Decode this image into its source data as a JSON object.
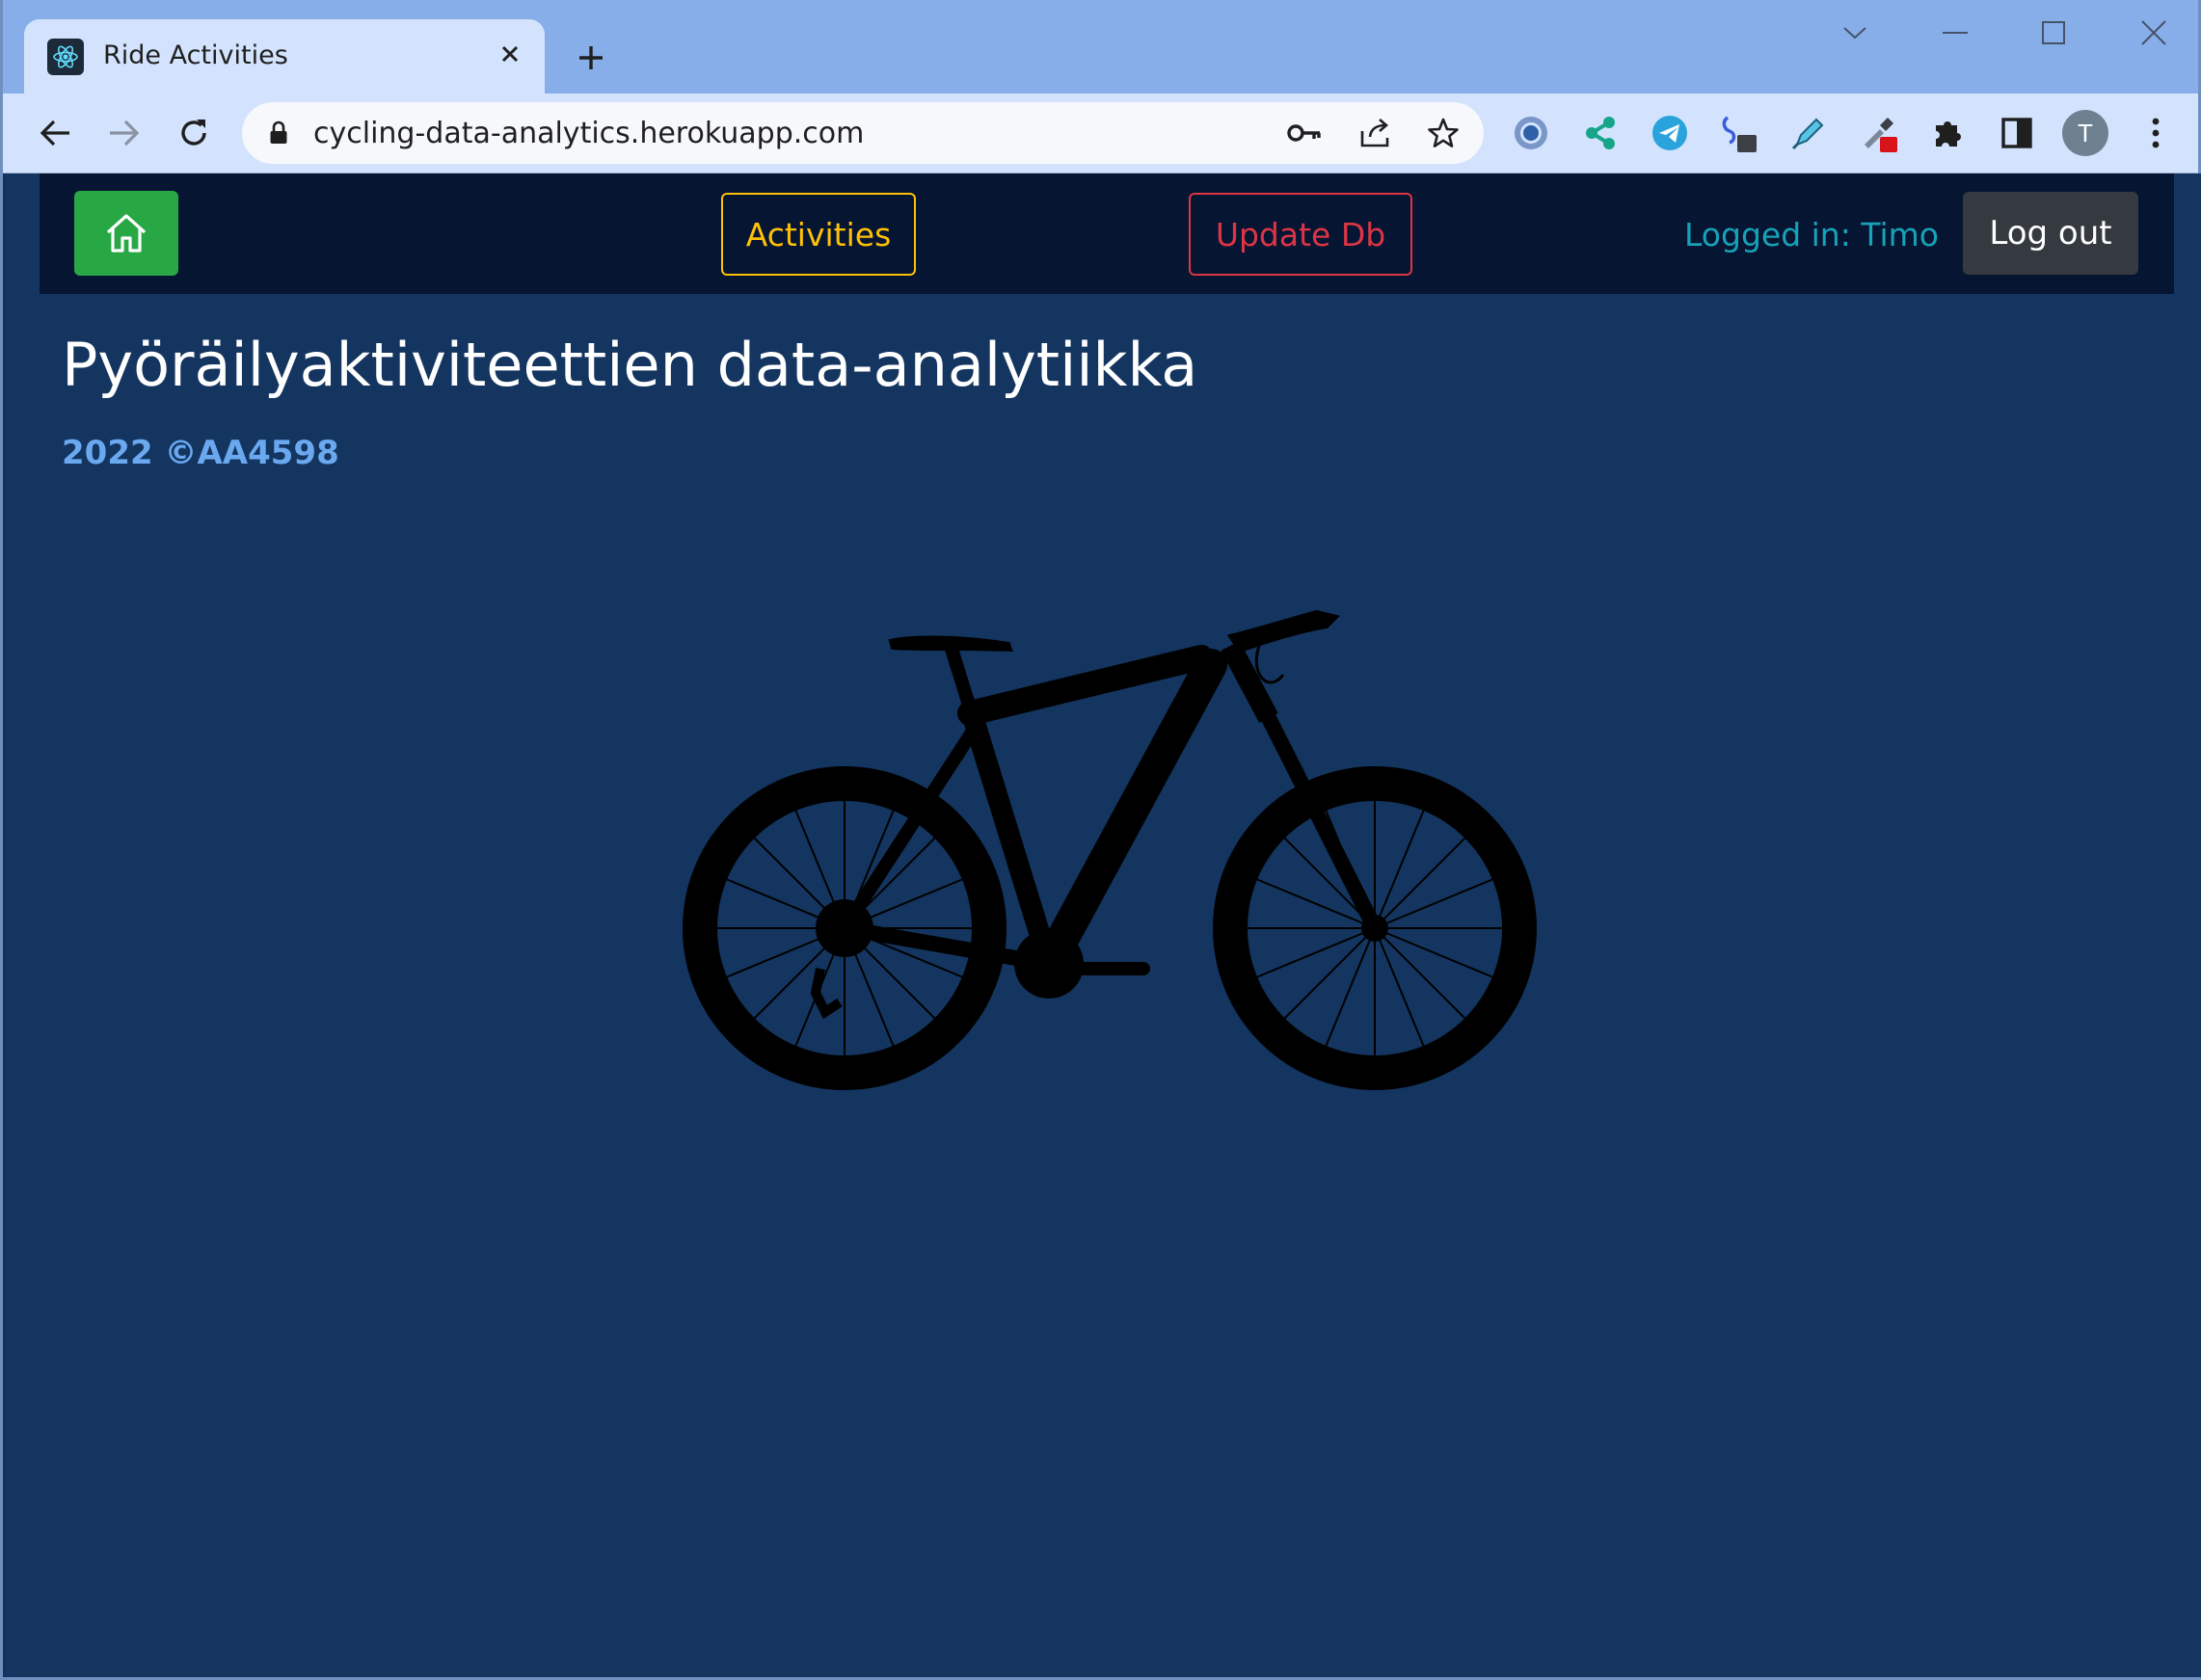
{
  "browser": {
    "tab": {
      "title": "Ride Activities",
      "favicon": "react-atom-icon"
    },
    "url": "cycling-data-analytics.herokuapp.com",
    "profile_initial": "T",
    "extensions": [
      "refresh-ring-icon",
      "share-nodes-icon",
      "telegram-icon",
      "link-icon",
      "highlighter-icon",
      "eyedropper-icon",
      "puzzle-icon"
    ]
  },
  "navbar": {
    "home_icon": "home-icon",
    "activities_label": "Activities",
    "update_label": "Update Db",
    "logged_in_text": "Logged in: Timo",
    "logout_label": "Log out"
  },
  "main": {
    "title": "Pyöräilyaktiviteettien data-analytiikka",
    "copyright": "2022 ©AA4598",
    "hero_image": "bicycle-silhouette"
  },
  "colors": {
    "page_bg": "#13355f",
    "navbar_bg": "#061532",
    "home_btn": "#28a745",
    "activities": "#ffc107",
    "update": "#dc3545",
    "logged_in": "#17a2b8",
    "copyright": "#6aa8ef"
  }
}
